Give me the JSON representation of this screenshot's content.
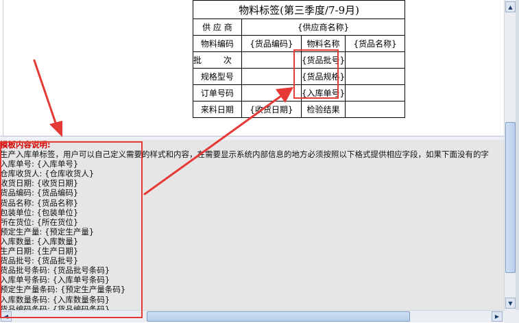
{
  "label_table": {
    "title": "物料标签(第三季度/7-9月)",
    "supplier_label": "供 应 商",
    "supplier_value": "{供应商名称}",
    "material_code_label": "物料编码",
    "material_code_value": "{货品编码}",
    "material_name_label": "物料名称",
    "material_name_value": "{货品名称}",
    "batch_label": "批 次",
    "batch_value": "{货品批号}",
    "spec_label": "规格型号",
    "spec_value": "{货品规格}",
    "order_label": "订单号码",
    "order_value": "{入库单号}",
    "arrival_label": "来料日期",
    "arrival_value": "{收货日期}",
    "inspection_label": "检验结果"
  },
  "notes": {
    "heading": "模板内容说明:",
    "intro": "生产入库单标签，用户可以自己定义需要的样式和内容，在需要显示系统内部信息的地方必须按照以下格式提供相应字段，如果下面没有的字",
    "lines": [
      "入库单号: {入库单号}",
      "仓库收货人: {仓库收货人}",
      "收货日期: {收货日期}",
      "货品编码: {货品编码}",
      "货品名称: {货品名称}",
      "包装单位: {包装单位}",
      "所在货位: {所在货位}",
      "预定生产量: {预定生产量}",
      "入库数量: {入库数量}",
      "生产日期: {生产日期}",
      "货品批号: {货品批号}",
      "货品批号条码: {货品批号条码}",
      "入库单号条码: {入库单号条码}",
      "预定生产量条码: {预定生产量条码}",
      "入库数量条码: {入库数量条码}",
      "货品编码条码: {货品编码条码}"
    ]
  },
  "scrollbar": {
    "up_icon": "▲",
    "down_icon": "▼",
    "left_icon": "◀",
    "right_icon": "▶"
  },
  "colors": {
    "annotation_red": "#e53935",
    "heading_red": "#d20000",
    "notes_background": "#e6e6e6"
  }
}
